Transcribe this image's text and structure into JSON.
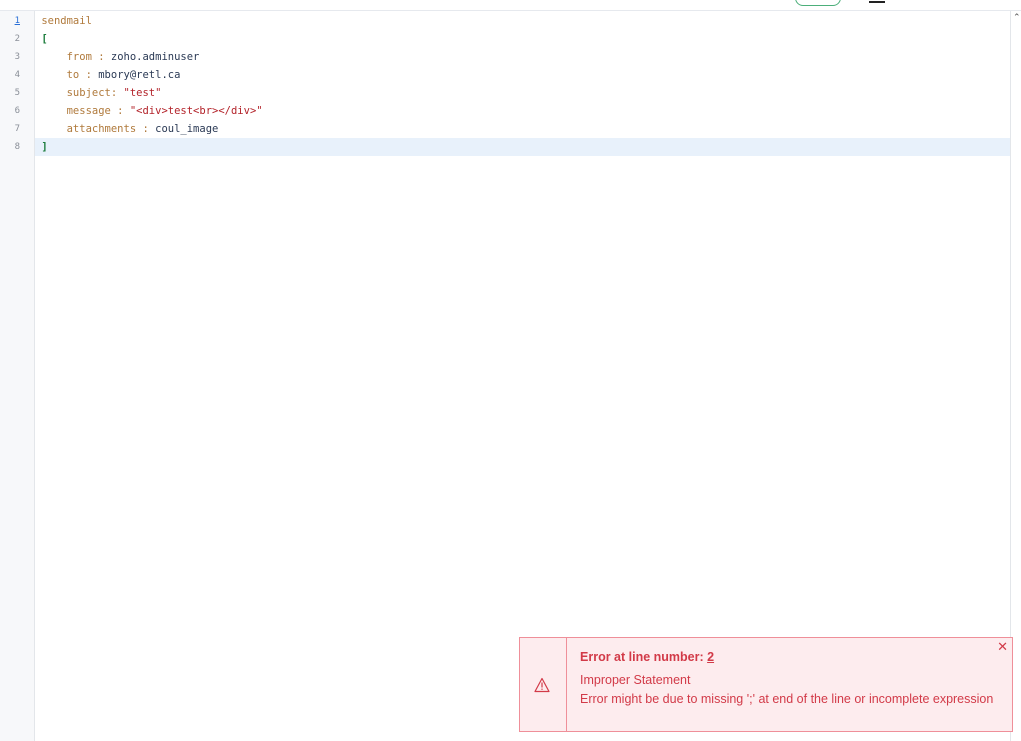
{
  "editor": {
    "line_numbers": [
      "1",
      "2",
      "3",
      "4",
      "5",
      "6",
      "7",
      "8"
    ],
    "lines": [
      {
        "tokens": [
          {
            "t": "sendmail",
            "c": "kw"
          }
        ]
      },
      {
        "tokens": [
          {
            "t": "[",
            "c": "bracket"
          }
        ]
      },
      {
        "tokens": [
          {
            "t": "    from : ",
            "c": "key"
          },
          {
            "t": "zoho.adminuser",
            "c": "val"
          }
        ]
      },
      {
        "tokens": [
          {
            "t": "    to : ",
            "c": "key"
          },
          {
            "t": "mbory@retl.ca",
            "c": "val"
          }
        ]
      },
      {
        "tokens": [
          {
            "t": "    subject: ",
            "c": "key"
          },
          {
            "t": "\"test\"",
            "c": "str"
          }
        ]
      },
      {
        "tokens": [
          {
            "t": "    message : ",
            "c": "key"
          },
          {
            "t": "\"<div>test<br></div>\"",
            "c": "str"
          }
        ]
      },
      {
        "tokens": [
          {
            "t": "    attachments : ",
            "c": "key"
          },
          {
            "t": "coul_image",
            "c": "val"
          }
        ]
      },
      {
        "tokens": [
          {
            "t": "]",
            "c": "bracket"
          }
        ]
      }
    ],
    "active_line_index": 0,
    "current_line_index": 7
  },
  "error": {
    "title_prefix": "Error at line number: ",
    "line_number": "2",
    "line1": "Improper Statement",
    "line2": "Error might be due to missing ';' at end of the line or incomplete expression",
    "close_glyph": "✕",
    "icon": "warning-triangle-icon"
  },
  "colors": {
    "error_text": "#d23a48",
    "error_bg": "#fdecee",
    "error_border": "#ef8f99",
    "current_line_bg": "#e8f1fb"
  }
}
